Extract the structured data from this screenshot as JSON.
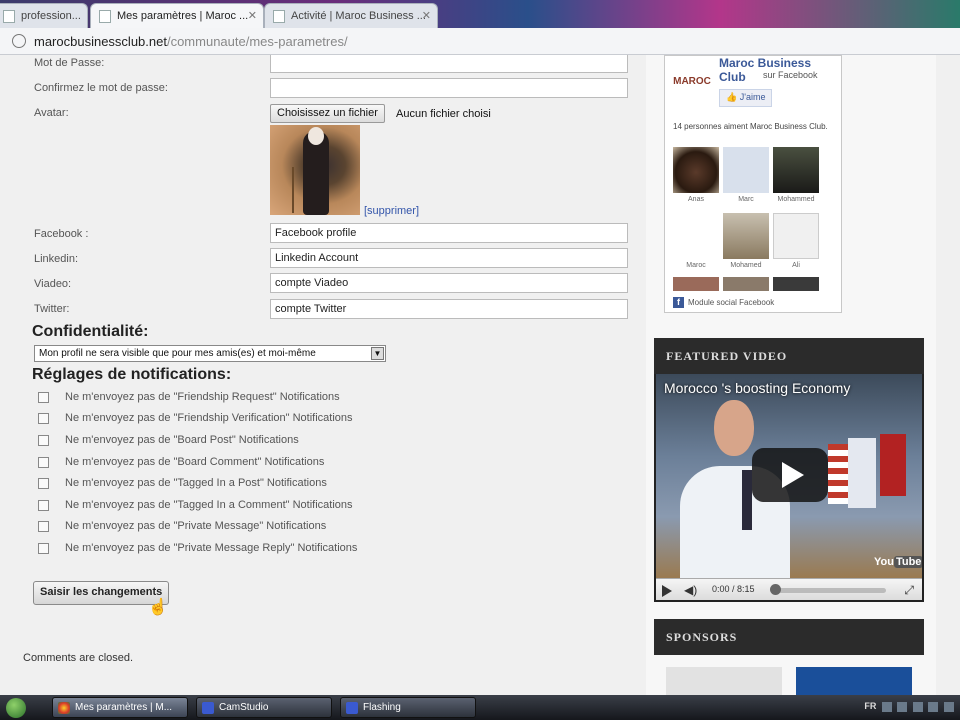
{
  "browser": {
    "tabs": [
      {
        "label": "profession..."
      },
      {
        "label": "Mes paramètres | Maroc ..."
      },
      {
        "label": "Activité | Maroc Business ..."
      }
    ],
    "url_domain": "marocbusinessclub.net",
    "url_path": "/communaute/mes-parametres/"
  },
  "form": {
    "password_label": "Mot de Passe:",
    "confirm_label": "Confirmez le mot de passe:",
    "avatar_label": "Avatar:",
    "file_button": "Choisissez un fichier",
    "file_status": "Aucun fichier choisi",
    "delete_link": "[supprimer]",
    "facebook_label": "Facebook :",
    "facebook_value": "Facebook profile",
    "linkedin_label": "Linkedin:",
    "linkedin_value": "Linkedin  Account",
    "viadeo_label": "Viadeo:",
    "viadeo_value": "compte Viadeo",
    "twitter_label": "Twitter:",
    "twitter_value": "compte Twitter"
  },
  "privacy": {
    "title": "Confidentialité:",
    "selected": "Mon profil ne sera visible que pour mes amis(es) et moi-même"
  },
  "notifications": {
    "title": "Réglages de notifications:",
    "items": [
      "Ne m'envoyez pas de \"Friendship Request\" Notifications",
      "Ne m'envoyez pas de \"Friendship Verification\" Notifications",
      "Ne m'envoyez pas de \"Board Post\" Notifications",
      "Ne m'envoyez pas de \"Board Comment\" Notifications",
      "Ne m'envoyez pas de \"Tagged In a Post\" Notifications",
      "Ne m'envoyez pas de \"Tagged In a Comment\" Notifications",
      "Ne m'envoyez pas de \"Private Message\" Notifications",
      "Ne m'envoyez pas de \"Private Message Reply\" Notifications"
    ]
  },
  "save_button": "Saisir les changements",
  "comments_closed": "Comments are closed.",
  "facebook_box": {
    "logo_text": "MAROC",
    "page_name": "Maroc Business Club",
    "sub": "sur Facebook",
    "like_button": "J'aime",
    "count_text": "14 personnes aiment Maroc Business Club.",
    "fans": [
      {
        "name": "Anas"
      },
      {
        "name": "Marc"
      },
      {
        "name": "Mohammed"
      },
      {
        "name": "Maroc"
      },
      {
        "name": "Mohamed"
      },
      {
        "name": "Ali"
      }
    ],
    "footer": "Module social Facebook",
    "fb_letter": "f"
  },
  "featured_video": {
    "header": "FEATURED VIDEO",
    "title": "Morocco 's boosting Economy",
    "time": "0:00 / 8:15",
    "yt_you": "You",
    "yt_tube": "Tube"
  },
  "sponsors": {
    "header": "SPONSORS"
  },
  "taskbar": {
    "tasks": [
      {
        "label": "Mes paramètres | M..."
      },
      {
        "label": "CamStudio"
      },
      {
        "label": "Flashing"
      }
    ],
    "lang": "FR"
  },
  "colors": {
    "facebook_blue": "#3b5998",
    "link": "#3355aa"
  }
}
